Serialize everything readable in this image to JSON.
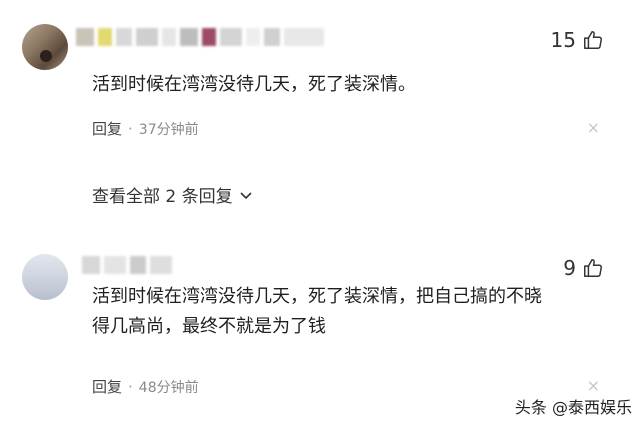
{
  "comments": [
    {
      "likes": "15",
      "text": "活到时候在湾湾没待几天，死了装深情。",
      "reply_label": "回复",
      "separator": "·",
      "time": "37分钟前",
      "close": "×"
    },
    {
      "likes": "9",
      "text_line1": "活到时候在湾湾没待几天，死了装深情，把自己搞的不晓",
      "text_line2": "得几高尚，最终不就是为了钱",
      "reply_label": "回复",
      "separator": "·",
      "time": "48分钟前",
      "close": "×"
    }
  ],
  "view_replies": "查看全部 2 条回复",
  "watermark": "头条 @泰西娱乐",
  "icons": {
    "like": "thumbs-up-icon",
    "chevron": "chevron-down-icon",
    "close": "close-icon"
  }
}
